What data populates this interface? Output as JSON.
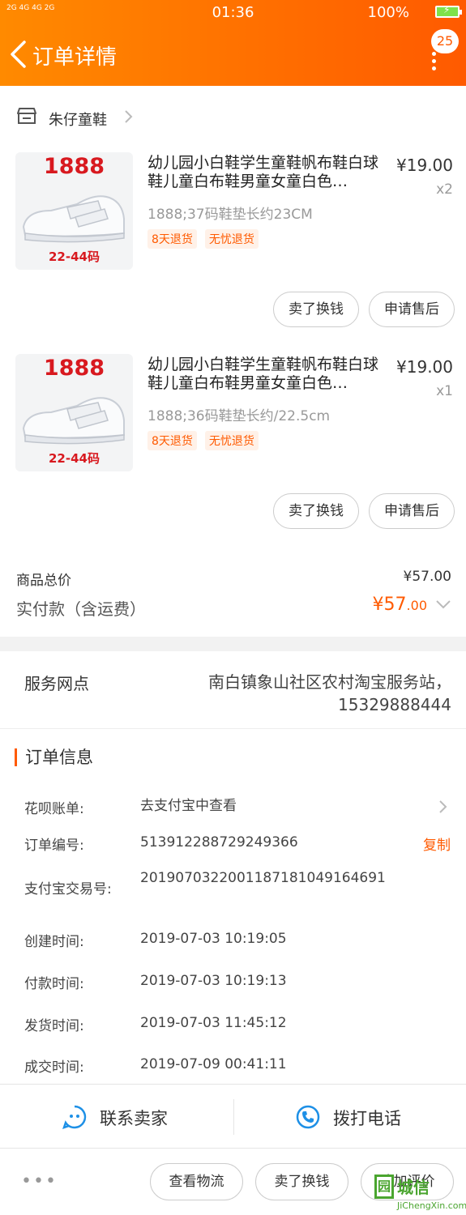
{
  "status_bar": {
    "signal": "2G 4G 4G 2G",
    "time": "01:36",
    "battery": "100%"
  },
  "header": {
    "title": "订单详情",
    "badge": "25"
  },
  "shop": {
    "name": "朱仔童鞋"
  },
  "items": [
    {
      "thumb_number": "1888",
      "thumb_size": "22-44码",
      "title": "幼儿园小白鞋学生童鞋帆布鞋白球鞋儿童白布鞋男童女童白色…",
      "price": "¥19.00",
      "qty": "x2",
      "sku": "1888;37码鞋垫长约23CM",
      "tags": [
        "8天退货",
        "无忧退货"
      ],
      "buttons": [
        "卖了换钱",
        "申请售后"
      ]
    },
    {
      "thumb_number": "1888",
      "thumb_size": "22-44码",
      "title": "幼儿园小白鞋学生童鞋帆布鞋白球鞋儿童白布鞋男童女童白色…",
      "price": "¥19.00",
      "qty": "x1",
      "sku": "1888;36码鞋垫长约/22.5cm",
      "tags": [
        "8天退货",
        "无忧退货"
      ],
      "buttons": [
        "卖了换钱",
        "申请售后"
      ]
    }
  ],
  "totals": {
    "goods_label": "商品总价",
    "goods_value": "¥57.00",
    "paid_label": "实付款（含运费）",
    "paid_symbol": "¥",
    "paid_int": "57",
    "paid_dec": ".00"
  },
  "service": {
    "label": "服务网点",
    "value": "南白镇象山社区农村淘宝服务站，15329888444"
  },
  "order_info": {
    "heading": "订单信息",
    "rows": [
      {
        "k": "花呗账单:",
        "v": "去支付宝中查看"
      },
      {
        "k": "订单编号:",
        "v": "513912288729249366",
        "action": "复制"
      },
      {
        "k": "支付宝交易号:",
        "v": "2019070322001187181049164691"
      },
      {
        "k": "创建时间:",
        "v": "2019-07-03 10:19:05"
      },
      {
        "k": "付款时间:",
        "v": "2019-07-03 10:19:13"
      },
      {
        "k": "发货时间:",
        "v": "2019-07-03 11:45:12"
      },
      {
        "k": "成交时间:",
        "v": "2019-07-09 00:41:11"
      }
    ]
  },
  "contact": {
    "seller": "联系卖家",
    "phone": "拨打电话"
  },
  "footer": {
    "dots": "•••",
    "buttons": [
      "查看物流",
      "卖了换钱",
      "追加评价"
    ]
  },
  "watermark": {
    "logo_char": "园",
    "text": "城信",
    "url": "JiChengXin.com"
  },
  "colors": {
    "brand": "#ff5a00",
    "brand_light": "#ff8a00",
    "price_red": "#d8191f",
    "watermark_green": "#4aa52f"
  }
}
